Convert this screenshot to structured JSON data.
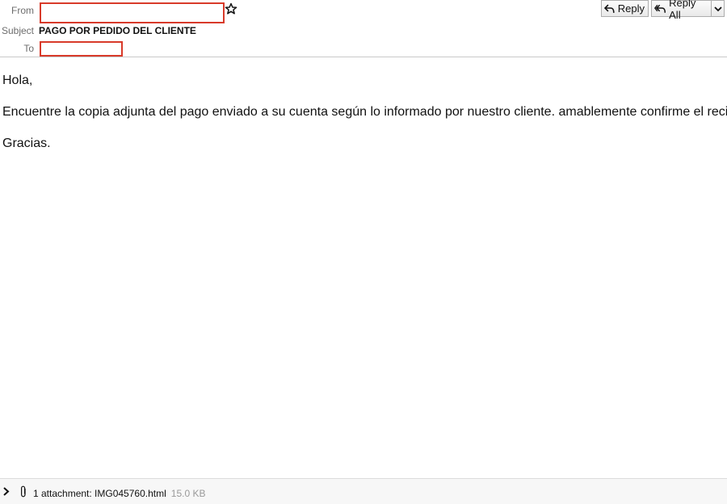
{
  "header": {
    "from_label": "From",
    "subject_label": "Subject",
    "subject": "PAGO POR PEDIDO DEL CLIENTE",
    "to_label": "To",
    "reply_label": "Reply",
    "reply_all_label": "Reply All"
  },
  "message": {
    "greeting": "Hola,",
    "body": "Encuentre la copia adjunta del pago enviado a su cuenta según lo informado por nuestro cliente. amablemente confirme el recibo",
    "closing": "Gracias."
  },
  "attachment": {
    "summary": "1 attachment: IMG045760.html",
    "size": "15.0 KB"
  },
  "colors": {
    "redaction": "#d83a2a",
    "label": "#6d6d6d",
    "divider": "#c9c9c9"
  },
  "icons": [
    "star-icon",
    "reply-icon",
    "reply-all-icon",
    "chevron-down-icon",
    "expand-chevron-icon",
    "paperclip-icon"
  ]
}
